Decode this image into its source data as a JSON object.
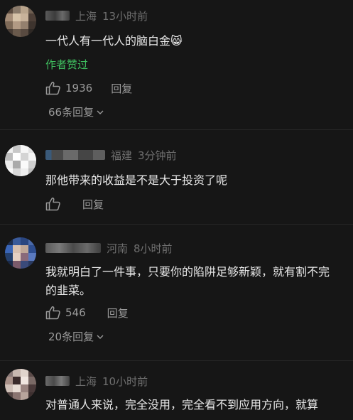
{
  "comments": [
    {
      "region": "上海",
      "time": "13小时前",
      "text": "一代人有一代人的脑白金😸",
      "badge": "作者赞过",
      "likes": "1936",
      "reply_label": "回复",
      "more_replies": "66条回复"
    },
    {
      "region": "福建",
      "time": "3分钟前",
      "text": "那他带来的收益是不是大于投资了呢",
      "likes": "",
      "reply_label": "回复"
    },
    {
      "region": "河南",
      "time": "8小时前",
      "text": "我就明白了一件事，只要你的陷阱足够新颖，就有割不完的韭菜。",
      "likes": "546",
      "reply_label": "回复",
      "more_replies": "20条回复"
    },
    {
      "region": "上海",
      "time": "10小时前",
      "text": "对普通人来说，完全没用，完全看不到应用方向，就算"
    }
  ],
  "colors": {
    "background": "#161616",
    "text": "#e8e8e8",
    "meta": "#6f6f6f",
    "author_badge": "#3fbf5f",
    "action": "#9a9a9a"
  },
  "icons": {
    "like": "thumbs-up-icon",
    "expand": "chevron-down-icon"
  }
}
